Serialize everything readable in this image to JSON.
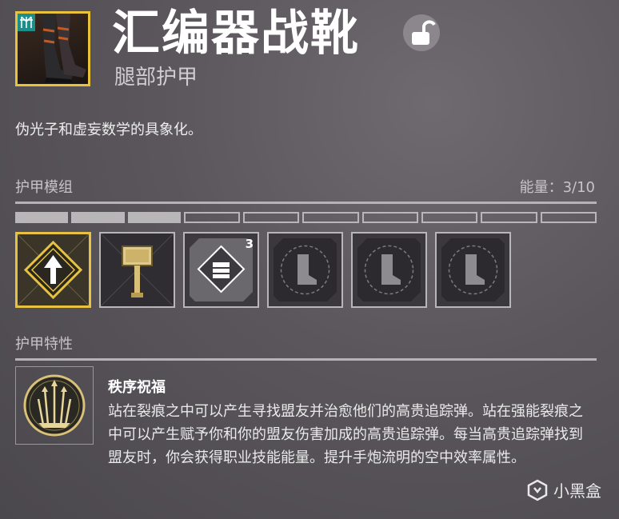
{
  "item": {
    "name": "汇编器战靴",
    "type": "腿部护甲",
    "description": "伪光子和虚妄数学的具象化。"
  },
  "mods": {
    "section_label": "护甲模组",
    "energy_label": "能量：3/10",
    "energy_used": 3,
    "energy_max": 10,
    "slots": [
      {
        "icon": "arc-diamond-mod-icon",
        "selected": true
      },
      {
        "icon": "hammer-mod-icon",
        "selected": false
      },
      {
        "icon": "fist-mod-icon",
        "selected": false,
        "cost": "3"
      },
      {
        "icon": "boot-placeholder-icon",
        "selected": false
      },
      {
        "icon": "boot-placeholder-icon",
        "selected": false
      },
      {
        "icon": "boot-placeholder-icon",
        "selected": false
      }
    ]
  },
  "perks": {
    "section_label": "护甲特性",
    "name": "秩序祝福",
    "description": "站在裂痕之中可以产生寻找盟友并治愈他们的高贵追踪弹。站在强能裂痕之中可以产生赋予你和你的盟友伤害加成的高贵追踪弹。每当高贵追踪弹找到盟友时，你会获得职业技能能量。提升手炮流明的空中效率属性。"
  },
  "watermark": {
    "text": "小黑盒"
  },
  "colors": {
    "accent_gold": "#e6c142",
    "class_tag_teal": "#1c8f8a"
  }
}
